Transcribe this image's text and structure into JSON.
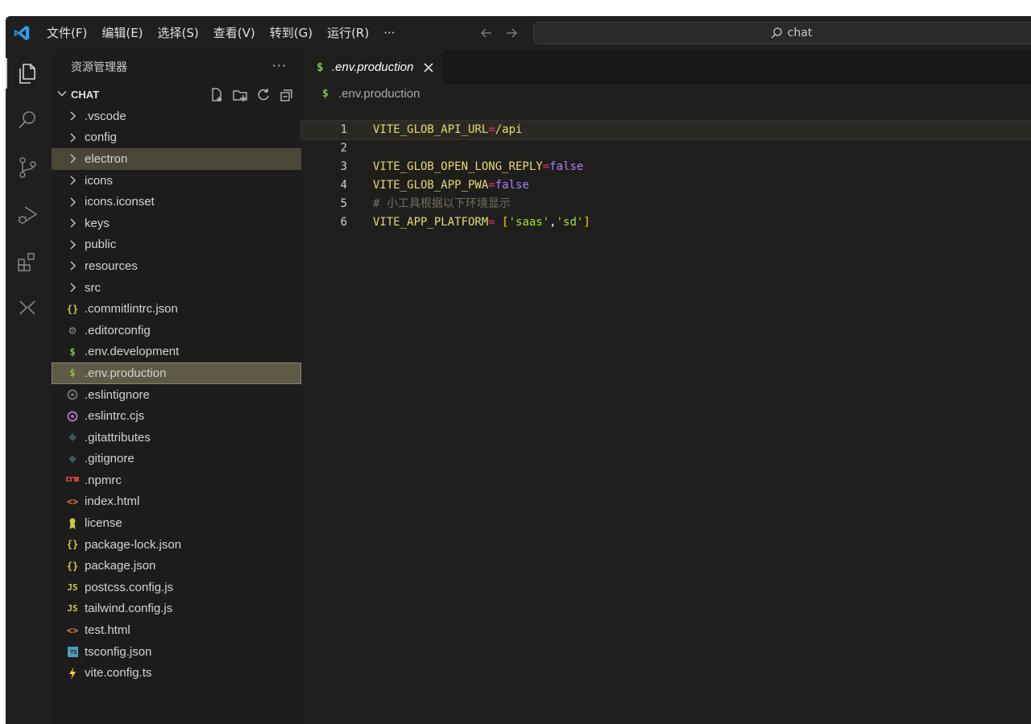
{
  "menu": [
    "文件(F)",
    "编辑(E)",
    "选择(S)",
    "查看(V)",
    "转到(G)",
    "运行(R)",
    "···"
  ],
  "command_center": {
    "text": "chat",
    "icon": "search-icon"
  },
  "activity_bar": [
    "explorer-icon",
    "search-icon",
    "source-control-icon",
    "run-debug-icon",
    "extensions-icon",
    "remote-icon"
  ],
  "sidebar": {
    "title": "资源管理器",
    "more": "···",
    "folder": "CHAT",
    "folder_actions": [
      "new-file-icon",
      "new-folder-icon",
      "refresh-icon",
      "collapse-all-icon"
    ],
    "items": [
      {
        "label": ".vscode",
        "type": "folder"
      },
      {
        "label": "config",
        "type": "folder"
      },
      {
        "label": "electron",
        "type": "folder"
      },
      {
        "label": "icons",
        "type": "folder"
      },
      {
        "label": "icons.iconset",
        "type": "folder"
      },
      {
        "label": "keys",
        "type": "folder"
      },
      {
        "label": "public",
        "type": "folder"
      },
      {
        "label": "resources",
        "type": "folder"
      },
      {
        "label": "src",
        "type": "folder"
      },
      {
        "label": ".commitlintrc.json",
        "type": "json"
      },
      {
        "label": ".editorconfig",
        "type": "gear"
      },
      {
        "label": ".env.development",
        "type": "env"
      },
      {
        "label": ".env.production",
        "type": "env"
      },
      {
        "label": ".eslintignore",
        "type": "eslint-gray"
      },
      {
        "label": ".eslintrc.cjs",
        "type": "eslint"
      },
      {
        "label": ".gitattributes",
        "type": "git"
      },
      {
        "label": ".gitignore",
        "type": "git"
      },
      {
        "label": ".npmrc",
        "type": "npm"
      },
      {
        "label": "index.html",
        "type": "html"
      },
      {
        "label": "license",
        "type": "license"
      },
      {
        "label": "package-lock.json",
        "type": "json"
      },
      {
        "label": "package.json",
        "type": "json"
      },
      {
        "label": "postcss.config.js",
        "type": "js"
      },
      {
        "label": "tailwind.config.js",
        "type": "js"
      },
      {
        "label": "test.html",
        "type": "html"
      },
      {
        "label": "tsconfig.json",
        "type": "ts"
      },
      {
        "label": "vite.config.ts",
        "type": "vite"
      }
    ],
    "hover_item": "electron",
    "selected_item": ".env.production"
  },
  "editor": {
    "tab": {
      "label": ".env.production",
      "icon": "$"
    },
    "breadcrumb": {
      "label": ".env.production",
      "icon": "$"
    },
    "lines": [
      {
        "n": "1",
        "key": "VITE_GLOB_API_URL",
        "eq": "=",
        "val": "/api",
        "kind": "string"
      },
      {
        "n": "2"
      },
      {
        "n": "3",
        "key": "VITE_GLOB_OPEN_LONG_REPLY",
        "eq": "=",
        "val": "false",
        "kind": "bool"
      },
      {
        "n": "4",
        "key": "VITE_GLOB_APP_PWA",
        "eq": "=",
        "val": "false",
        "kind": "bool"
      },
      {
        "n": "5",
        "comment": "# 小工具根据以下环境显示"
      },
      {
        "n": "6",
        "key": "VITE_APP_PLATFORM",
        "eq": "=",
        "array_open": " [",
        "items": [
          "'saas'",
          "'sd'"
        ],
        "sep": ",",
        "array_close": "]",
        "kind": "array"
      }
    ],
    "current_line": "1"
  },
  "colors": {
    "env_icon": "#8dc149",
    "json_icon": "#cbcb41",
    "js_icon": "#cbcb41",
    "html_icon": "#e37933",
    "ts_icon": "#519aba",
    "eslint_icon": "#a074c4",
    "npm_icon": "#cc3e44"
  }
}
